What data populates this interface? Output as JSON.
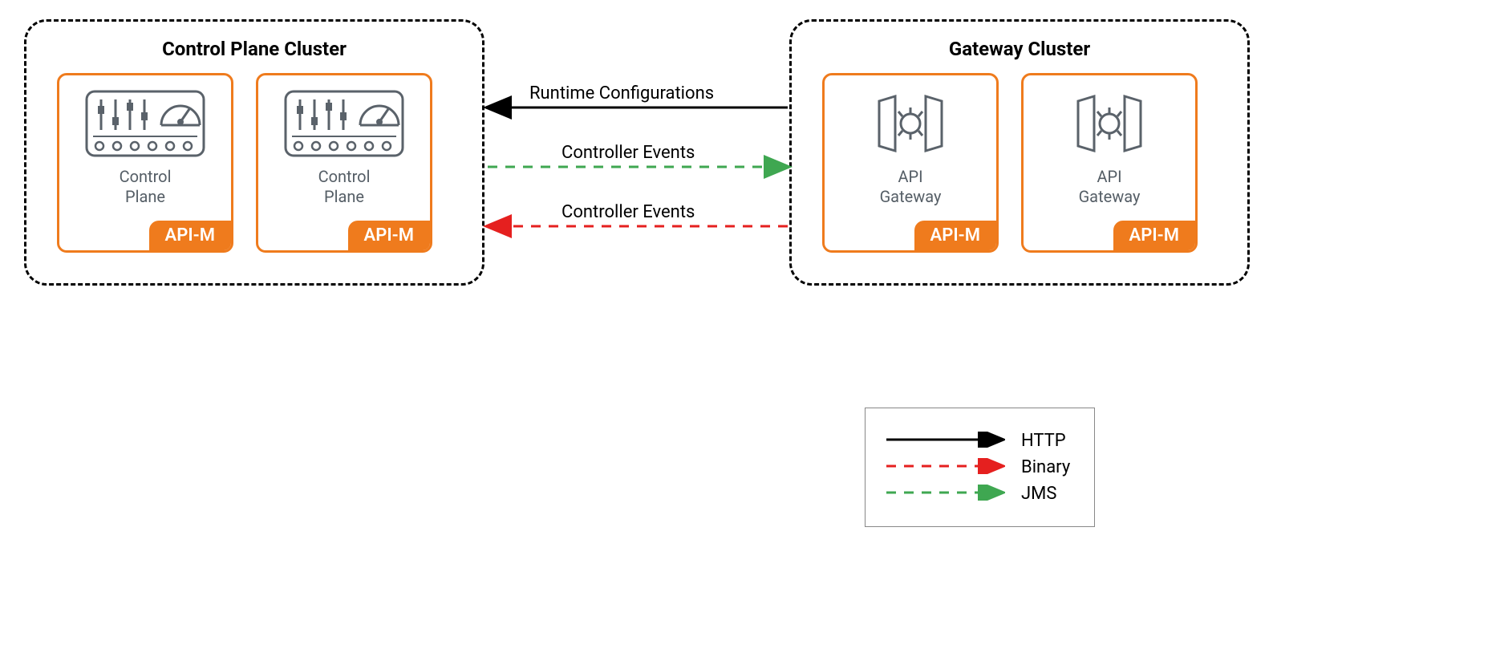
{
  "clusters": {
    "left": {
      "title": "Control Plane Cluster",
      "nodes": [
        {
          "label": "Control\nPlane",
          "badge": "API-M"
        },
        {
          "label": "Control\nPlane",
          "badge": "API-M"
        }
      ]
    },
    "right": {
      "title": "Gateway Cluster",
      "nodes": [
        {
          "label": "API\nGateway",
          "badge": "API-M"
        },
        {
          "label": "API\nGateway",
          "badge": "API-M"
        }
      ]
    }
  },
  "connectors": [
    {
      "label": "Runtime Configurations",
      "direction": "left",
      "style": "solid",
      "color": "#000000"
    },
    {
      "label": "Controller Events",
      "direction": "right",
      "style": "dashed",
      "color": "#3fa751"
    },
    {
      "label": "Controller Events",
      "direction": "left",
      "style": "dashed",
      "color": "#e5201f"
    }
  ],
  "legend": [
    {
      "label": "HTTP",
      "style": "solid",
      "color": "#000000"
    },
    {
      "label": "Binary",
      "style": "dashed",
      "color": "#e5201f"
    },
    {
      "label": "JMS",
      "style": "dashed",
      "color": "#3fa751"
    }
  ],
  "colors": {
    "accent": "#ef7b1d",
    "iconStroke": "#5a626a"
  }
}
